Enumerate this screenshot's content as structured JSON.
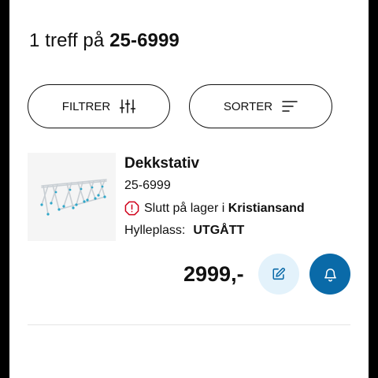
{
  "results": {
    "count_text": "1 treff på",
    "query": "25-6999"
  },
  "toolbar": {
    "filter_label": "FILTRER",
    "filter_icon": "sliders-icon",
    "sort_label": "SORTER",
    "sort_icon": "sort-lines-icon"
  },
  "product": {
    "name": "Dekkstativ",
    "number": "25-6999",
    "stock_prefix": "Slutt på lager i",
    "stock_location": "Kristiansand",
    "stock_icon": "alert-octagon-icon",
    "shelf_label": "Hylleplass:",
    "shelf_value": "UTGÅTT",
    "price": "2999,-",
    "edit_icon": "pencil-square-icon",
    "notify_icon": "bell-icon"
  },
  "colors": {
    "stock_alert": "#d0021b",
    "edit_button_bg": "#e3f2fb",
    "edit_icon": "#0a6aa8",
    "notify_button_bg": "#0a6aa8"
  }
}
